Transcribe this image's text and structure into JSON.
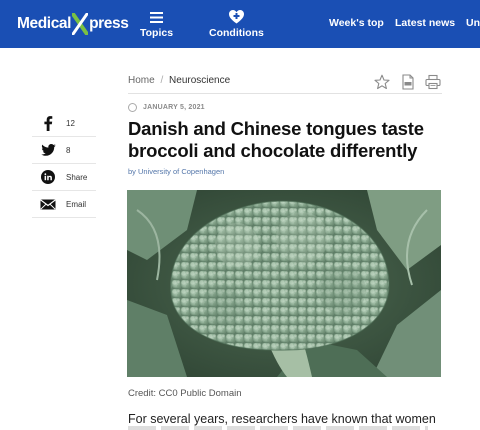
{
  "header": {
    "logo_left": "Medical",
    "logo_right": "press",
    "nav_topics": "Topics",
    "nav_conditions": "Conditions",
    "nav_weeks_top": "Week's top",
    "nav_latest": "Latest news",
    "nav_cut": "Unr",
    "brand_color": "#1a4fb4",
    "logo_x_color": "#7ac143"
  },
  "breadcrumb": {
    "home": "Home",
    "separator": "/",
    "current": "Neuroscience"
  },
  "tools": {
    "icons": [
      "star-icon",
      "pdf-icon",
      "print-icon"
    ]
  },
  "share": {
    "facebook_count": "12",
    "twitter_count": "8",
    "linkedin_label": "Share",
    "email_label": "Email"
  },
  "article": {
    "date": "JANUARY 5, 2021",
    "title": "Danish and Chinese tongues taste broccoli and chocolate differently",
    "byline": "by University of Copenhagen",
    "image_credit": "Credit: CC0 Public Domain",
    "body_first_line": "For several years, researchers have known that women are"
  }
}
